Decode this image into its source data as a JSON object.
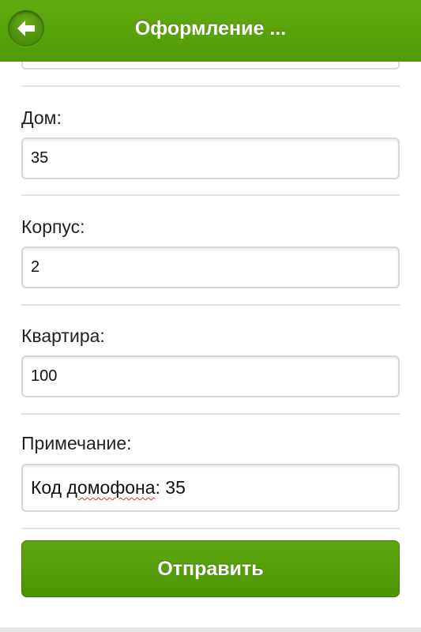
{
  "header": {
    "title": "Оформление ...",
    "back_icon": "back-arrow-icon"
  },
  "form": {
    "house": {
      "label": "Дом:",
      "value": "35"
    },
    "building": {
      "label": "Корпус:",
      "value": "2"
    },
    "apartment": {
      "label": "Квартира:",
      "value": "100"
    },
    "note": {
      "label": "Примечание:",
      "prefix": "Код ",
      "misspelled": "домофона",
      "suffix": ": 35"
    },
    "submit_label": "Отправить"
  },
  "colors": {
    "accent": "#5aa30e",
    "spellcheck": "#e03030"
  }
}
